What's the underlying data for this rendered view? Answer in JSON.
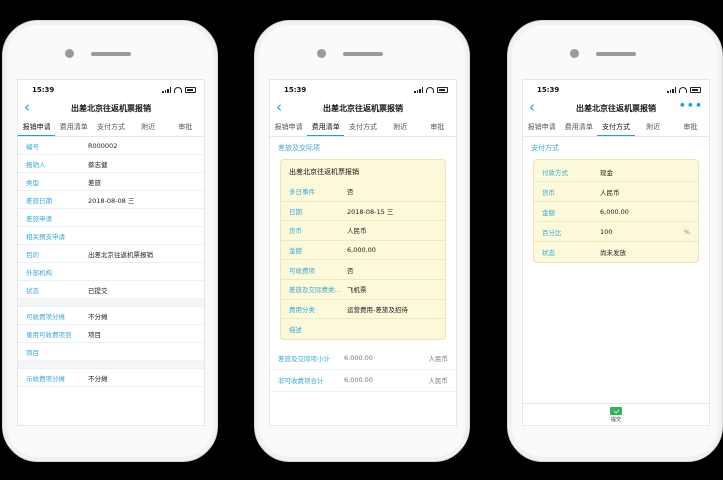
{
  "status": {
    "time": "15:39"
  },
  "screen1": {
    "title": "出差北京往返机票报销",
    "tabs": [
      "报销申请",
      "费用清单",
      "支付方式",
      "附近",
      "审批"
    ],
    "rows": [
      {
        "label": "编号",
        "value": "R000002"
      },
      {
        "label": "报销人",
        "value": "蔡志健"
      },
      {
        "label": "类型",
        "value": "差旅"
      },
      {
        "label": "差旅日期",
        "value": "2018-08-08 三"
      },
      {
        "label": "差旅申请",
        "value": ""
      },
      {
        "label": "相关预支申请",
        "value": ""
      },
      {
        "label": "目的",
        "value": "出差北京往返机票报销"
      },
      {
        "label": "外部机构",
        "value": ""
      },
      {
        "label": "状态",
        "value": "已提交"
      }
    ],
    "rows2": [
      {
        "label": "可收费项分摊",
        "value": "不分摊"
      },
      {
        "label": "录用可收费项到",
        "value": "项目"
      },
      {
        "label": "项目",
        "value": ""
      }
    ],
    "rows3": [
      {
        "label": "示收费项分摊",
        "value": "不分摊"
      }
    ]
  },
  "screen2": {
    "title": "出差北京往返机票报销",
    "tabs": [
      "报销申请",
      "费用清单",
      "支付方式",
      "附近",
      "审批"
    ],
    "section": "差旅及交际项",
    "card_title": "出差北京往返机票报销",
    "rows": [
      {
        "label": "多日事件",
        "value": "否"
      },
      {
        "label": "日期",
        "value": "2018-08-15 三"
      },
      {
        "label": "货币",
        "value": "人民币"
      },
      {
        "label": "金额",
        "value": "6,000.00"
      },
      {
        "label": "可收费项",
        "value": "否"
      },
      {
        "label": "差旅及交际费类...",
        "value": "飞机票"
      },
      {
        "label": "费用分类",
        "value": "运营费用-差旅及招待"
      },
      {
        "label": "描述",
        "value": ""
      }
    ],
    "sums": [
      {
        "label": "差旅及交际项小计",
        "value": "6,000.00",
        "currency": "人民币"
      },
      {
        "label": "非可收费项合计",
        "value": "6,000.00",
        "currency": "人民币"
      }
    ]
  },
  "screen3": {
    "title": "出差北京往返机票报销",
    "tabs": [
      "报销申请",
      "费用清单",
      "支付方式",
      "附近",
      "审批"
    ],
    "more": "•••",
    "section": "支付方式",
    "rows": [
      {
        "label": "付款方式",
        "value": "现金"
      },
      {
        "label": "货币",
        "value": "人民币"
      },
      {
        "label": "金额",
        "value": "6,000.00"
      },
      {
        "label": "百分比",
        "value": "100",
        "unit": "%"
      },
      {
        "label": "状态",
        "value": "尚未发放"
      }
    ],
    "submit_label": "提交"
  },
  "colors": {
    "accent": "#1aa1d8",
    "card_bg": "#fbf9d9",
    "submit": "#2fb457"
  },
  "icons": {
    "back": "back-arrow-icon",
    "more": "more-dots-icon",
    "submit": "submit-icon"
  }
}
